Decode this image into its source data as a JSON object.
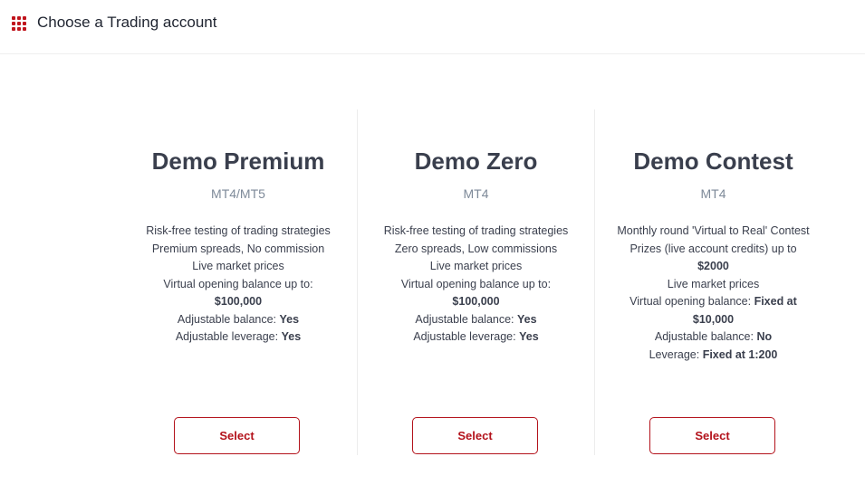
{
  "header": {
    "title": "Choose a Trading account",
    "icon": "grid-icon",
    "accent_color": "#c0141c"
  },
  "cards": [
    {
      "title": "Demo Premium",
      "platform": "MT4/MT5",
      "features": [
        {
          "text": "Risk-free testing of trading strategies"
        },
        {
          "text": "Premium spreads, No commission"
        },
        {
          "text": "Live market prices"
        },
        {
          "text": "Virtual opening balance up to:",
          "value": "$100,000",
          "break": true
        },
        {
          "text": "Adjustable balance:",
          "value": "Yes"
        },
        {
          "text": "Adjustable leverage:",
          "value": "Yes"
        }
      ],
      "button_label": "Select"
    },
    {
      "title": "Demo Zero",
      "platform": "MT4",
      "features": [
        {
          "text": "Risk-free testing of trading strategies"
        },
        {
          "text": "Zero spreads, Low commissions"
        },
        {
          "text": "Live market prices"
        },
        {
          "text": "Virtual opening balance up to:",
          "value": "$100,000",
          "break": true
        },
        {
          "text": "Adjustable balance:",
          "value": "Yes"
        },
        {
          "text": "Adjustable leverage:",
          "value": "Yes"
        }
      ],
      "button_label": "Select"
    },
    {
      "title": "Demo Contest",
      "platform": "MT4",
      "features": [
        {
          "text": "Monthly round 'Virtual to Real' Contest"
        },
        {
          "text": "Prizes (live account credits) up to",
          "value": "$2000",
          "break": true
        },
        {
          "text": "Live market prices"
        },
        {
          "text": "Virtual opening balance:",
          "value": "Fixed at $10,000"
        },
        {
          "text": "Adjustable balance:",
          "value": "No"
        },
        {
          "text": "Leverage:",
          "value": "Fixed at 1:200"
        }
      ],
      "button_label": "Select"
    }
  ]
}
